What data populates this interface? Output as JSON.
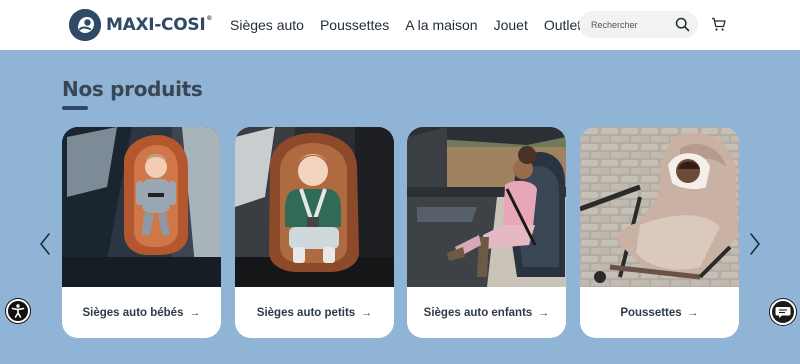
{
  "brand": {
    "name": "MAXI-COSI",
    "registered_mark": "®",
    "logo_icon": "maxi-cosi-logo-icon"
  },
  "nav": {
    "items": [
      {
        "label": "Sièges auto"
      },
      {
        "label": "Poussettes"
      },
      {
        "label": "A la maison"
      },
      {
        "label": "Jouet"
      },
      {
        "label": "Outlet"
      }
    ]
  },
  "search": {
    "placeholder": "Rechercher",
    "value": "",
    "icon": "search-icon"
  },
  "cart": {
    "icon": "cart-icon"
  },
  "section": {
    "title": "Nos produits"
  },
  "products": [
    {
      "label": "Sièges auto bébés",
      "arrow": "→",
      "image": "infant-car-seat-photo"
    },
    {
      "label": "Sièges auto petits",
      "arrow": "→",
      "image": "toddler-car-seat-photo"
    },
    {
      "label": "Sièges auto enfants",
      "arrow": "→",
      "image": "child-car-seat-photo"
    },
    {
      "label": "Poussettes",
      "arrow": "→",
      "image": "stroller-photo"
    }
  ],
  "carousel": {
    "prev_icon": "chevron-left-icon",
    "next_icon": "chevron-right-icon"
  },
  "widgets": {
    "accessibility_icon": "accessibility-icon",
    "chat_icon": "chat-icon"
  },
  "colors": {
    "page_background": "#8fb4d6",
    "brand_navy": "#2f4a66",
    "header_background": "#ffffff",
    "card_background": "#ffffff"
  }
}
